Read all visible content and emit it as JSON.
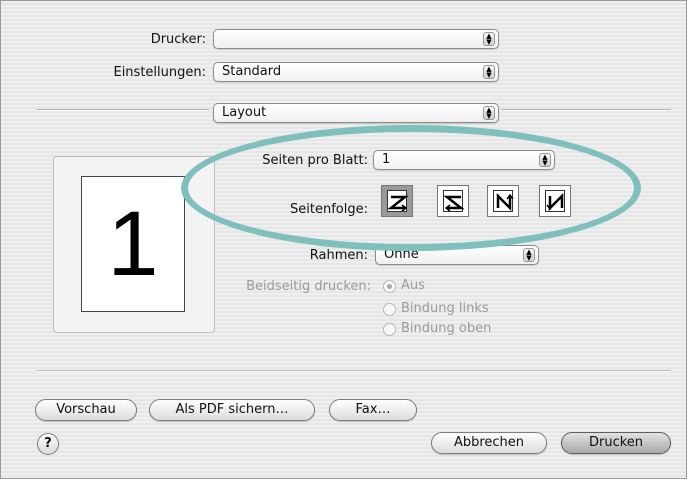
{
  "printer": {
    "label": "Drucker:",
    "value": ""
  },
  "settings": {
    "label": "Einstellungen:",
    "value": "Standard"
  },
  "panel": {
    "value": "Layout"
  },
  "preview": {
    "page_number": "1"
  },
  "pages_per_sheet": {
    "label": "Seiten pro Blatt:",
    "value": "1"
  },
  "page_order": {
    "label": "Seitenfolge:",
    "options": [
      "z-order-icon",
      "reverse-z-order-icon",
      "n-order-icon",
      "reverse-n-order-icon"
    ],
    "selected": 0
  },
  "border": {
    "label": "Rahmen:",
    "value": "Ohne"
  },
  "duplex": {
    "label": "Beidseitig drucken:",
    "options": [
      "Aus",
      "Bindung links",
      "Bindung oben"
    ],
    "selected": "Aus"
  },
  "buttons": {
    "preview": "Vorschau",
    "save_pdf": "Als PDF sichern…",
    "fax": "Fax…",
    "cancel": "Abbrechen",
    "print": "Drucken",
    "help": "?"
  },
  "colors": {
    "highlight": "#7fbfbe"
  }
}
